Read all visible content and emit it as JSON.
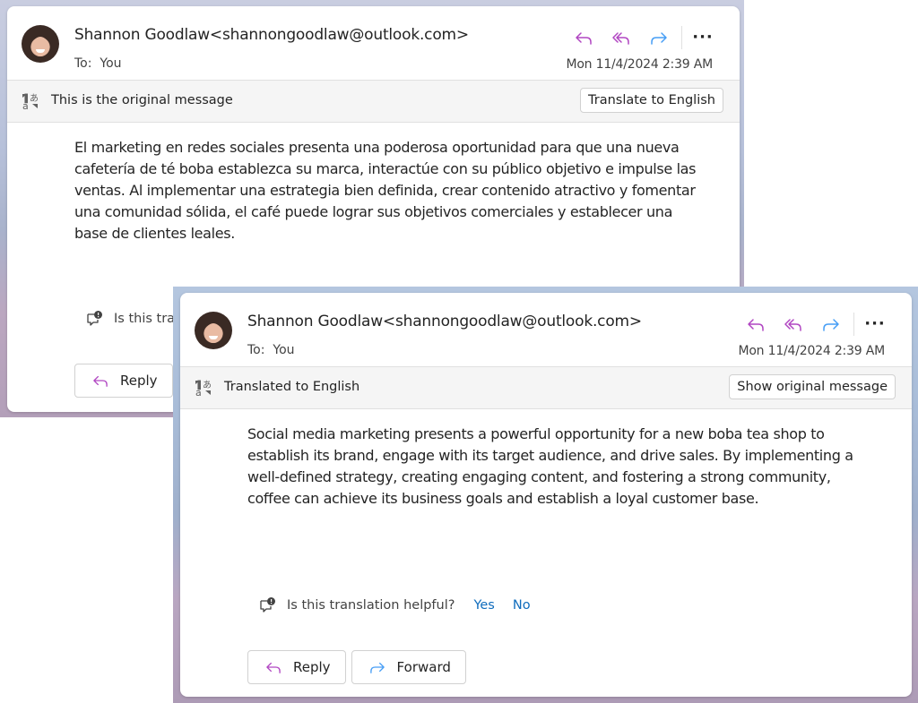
{
  "colors": {
    "reply_icon": "#b146c2",
    "forward_icon": "#479ef5",
    "link": "#0f6cbd"
  },
  "windows": [
    {
      "id": "original",
      "sender_name": "Shannon Goodlaw",
      "sender_email": "<shannongoodlaw@outlook.com>",
      "to_label": "To:",
      "to_value": "You",
      "date": "Mon 11/4/2024 2:39 AM",
      "actions": [
        {
          "name": "reply",
          "icon": "reply-icon"
        },
        {
          "name": "reply-all",
          "icon": "reply-all-icon"
        },
        {
          "name": "forward",
          "icon": "forward-icon"
        },
        {
          "name": "more",
          "icon": "more-icon",
          "label": "···"
        }
      ],
      "translation_bar": {
        "icon": "translate-icon",
        "label": "This is the original message",
        "button_label": "Translate to English"
      },
      "body": "El marketing en redes sociales presenta una poderosa oportunidad para que una nueva cafetería de té boba establezca su marca, interactúe con su público objetivo e impulse las ventas. Al implementar una estrategia bien definida, crear contenido atractivo y fomentar una comunidad sólida, el café puede lograr sus objetivos comerciales y establecer una base de clientes leales.",
      "feedback": {
        "icon": "feedback-icon",
        "question_visible": "Is this tra"
      },
      "footer_buttons": [
        {
          "label": "Reply",
          "icon": "reply-icon"
        }
      ]
    },
    {
      "id": "translated",
      "sender_name": "Shannon Goodlaw",
      "sender_email": "<shannongoodlaw@outlook.com>",
      "to_label": "To:",
      "to_value": "You",
      "date": "Mon 11/4/2024 2:39 AM",
      "actions": [
        {
          "name": "reply",
          "icon": "reply-icon"
        },
        {
          "name": "reply-all",
          "icon": "reply-all-icon"
        },
        {
          "name": "forward",
          "icon": "forward-icon"
        },
        {
          "name": "more",
          "icon": "more-icon",
          "label": "···"
        }
      ],
      "translation_bar": {
        "icon": "translate-icon",
        "label": "Translated to English",
        "button_label": "Show original message"
      },
      "body": "Social media marketing presents a powerful opportunity for a new boba tea shop to establish its brand, engage with its target audience, and drive sales. By implementing a well-defined strategy, creating engaging content, and fostering a strong community, coffee can achieve its business goals and establish a loyal customer base.",
      "feedback": {
        "icon": "feedback-icon",
        "question": "Is this translation helpful?",
        "yes_label": "Yes",
        "no_label": "No"
      },
      "footer_buttons": [
        {
          "label": "Reply",
          "icon": "reply-icon"
        },
        {
          "label": "Forward",
          "icon": "forward-icon"
        }
      ]
    }
  ]
}
